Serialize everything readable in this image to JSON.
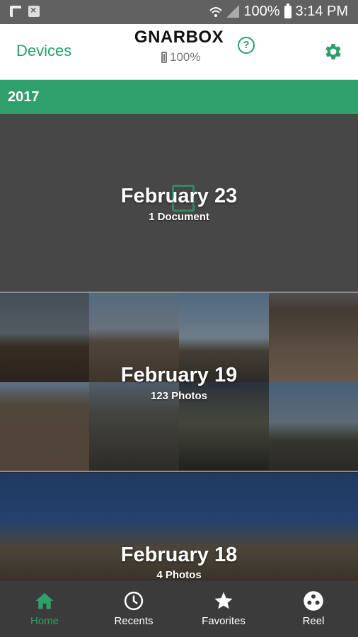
{
  "status_bar": {
    "battery": "100%",
    "time": "3:14 PM"
  },
  "header": {
    "devices_label": "Devices",
    "title": "GNARBOX",
    "battery": "100%"
  },
  "year": "2017",
  "sections": [
    {
      "date": "February 23",
      "count": "1 Document"
    },
    {
      "date": "February 19",
      "count": "123 Photos"
    },
    {
      "date": "February 18",
      "count": "4 Photos"
    }
  ],
  "nav": [
    {
      "label": "Home",
      "icon": "home-icon",
      "active": true
    },
    {
      "label": "Recents",
      "icon": "clock-icon"
    },
    {
      "label": "Favorites",
      "icon": "star-icon"
    },
    {
      "label": "Reel",
      "icon": "reel-icon"
    }
  ],
  "colors": {
    "accent": "#2ea06a",
    "header_bg": "#ffffff",
    "nav_bg": "#3b3b3b"
  }
}
